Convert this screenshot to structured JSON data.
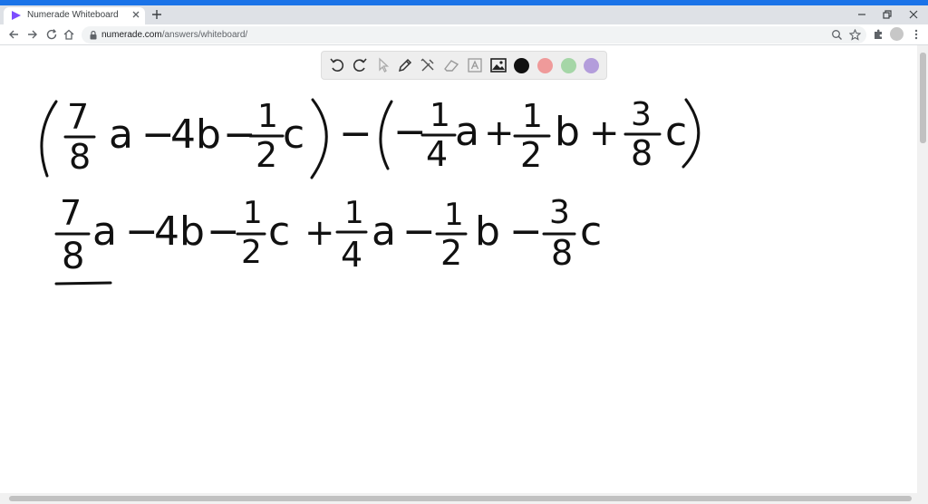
{
  "browser": {
    "tab_title": "Numerade Whiteboard",
    "url_domain": "numerade.com",
    "url_path": "/answers/whiteboard/",
    "accent_color": "#1a73e8"
  },
  "whiteboard_tools": {
    "tools": [
      "undo-icon",
      "redo-icon",
      "pointer-icon",
      "pen-icon",
      "tools-icon",
      "eraser-icon",
      "text-icon",
      "image-icon"
    ],
    "colors": [
      "#111111",
      "#ef9a9a",
      "#a5d6a7",
      "#b39ddb"
    ]
  },
  "board": {
    "line1": {
      "f1_num": "7",
      "f1_den": "8",
      "t1": "a",
      "op1": "−",
      "t2": "4b",
      "op2": "−",
      "f2_num": "1",
      "f2_den": "2",
      "t3": "c",
      "op_mid": "−",
      "neg": "−",
      "f3_num": "1",
      "f3_den": "4",
      "t4": "a",
      "op3": "+",
      "f4_num": "1",
      "f4_den": "2",
      "t5": "b",
      "op4": "+",
      "f5_num": "3",
      "f5_den": "8",
      "t6": "c"
    },
    "line2": {
      "f1_num": "7",
      "f1_den": "8",
      "t1": "a",
      "op1": "−",
      "t2": "4b",
      "op2": "−",
      "f2_num": "1",
      "f2_den": "2",
      "t3": "c",
      "op3": "+",
      "f3_num": "1",
      "f3_den": "4",
      "t4": "a",
      "op4": "−",
      "f4_num": "1",
      "f4_den": "2",
      "t5": "b",
      "op5": "−",
      "f5_num": "3",
      "f5_den": "8",
      "t6": "c"
    }
  }
}
